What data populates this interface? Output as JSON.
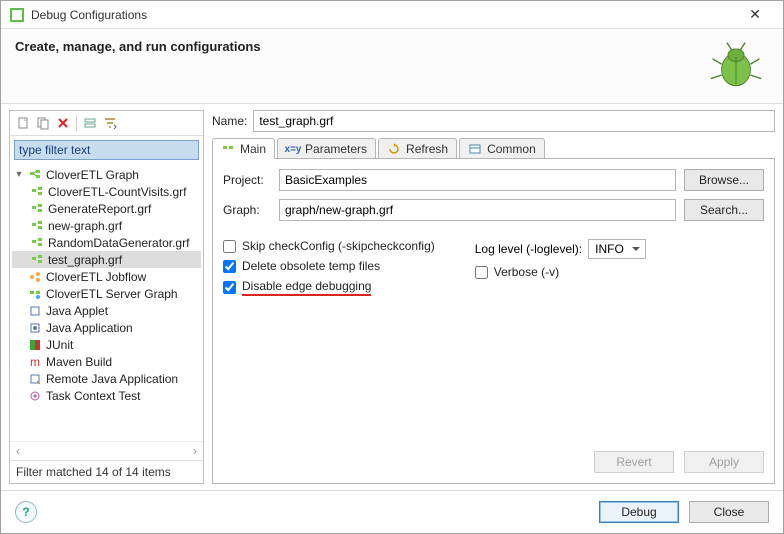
{
  "window": {
    "title": "Debug Configurations"
  },
  "header": {
    "subtitle": "Create, manage, and run configurations"
  },
  "filter": {
    "placeholder": "type filter text"
  },
  "tree": {
    "groups": [
      {
        "label": "CloverETL Graph",
        "expanded": true,
        "children": [
          {
            "label": "CloverETL-CountVisits.grf"
          },
          {
            "label": "GenerateReport.grf"
          },
          {
            "label": "new-graph.grf"
          },
          {
            "label": "RandomDataGenerator.grf"
          },
          {
            "label": "test_graph.grf",
            "selected": true
          }
        ]
      },
      {
        "label": "CloverETL Jobflow"
      },
      {
        "label": "CloverETL Server Graph"
      },
      {
        "label": "Java Applet"
      },
      {
        "label": "Java Application"
      },
      {
        "label": "JUnit"
      },
      {
        "label": "Maven Build"
      },
      {
        "label": "Remote Java Application"
      },
      {
        "label": "Task Context Test"
      }
    ],
    "footer": "Filter matched 14 of 14 items"
  },
  "name_row": {
    "label": "Name:",
    "value": "test_graph.grf"
  },
  "tabs": {
    "main": "Main",
    "parameters": "Parameters",
    "refresh": "Refresh",
    "common": "Common"
  },
  "form": {
    "project_label": "Project:",
    "project_value": "BasicExamples",
    "browse": "Browse...",
    "graph_label": "Graph:",
    "graph_value": "graph/new-graph.grf",
    "search": "Search..."
  },
  "options": {
    "skip": "Skip checkConfig (-skipcheckconfig)",
    "delete": "Delete obsolete temp files",
    "disable": "Disable edge debugging",
    "loglevel_label": "Log level (-loglevel):",
    "loglevel_value": "INFO",
    "verbose": "Verbose (-v)"
  },
  "buttons": {
    "revert": "Revert",
    "apply": "Apply",
    "debug": "Debug",
    "close": "Close"
  }
}
